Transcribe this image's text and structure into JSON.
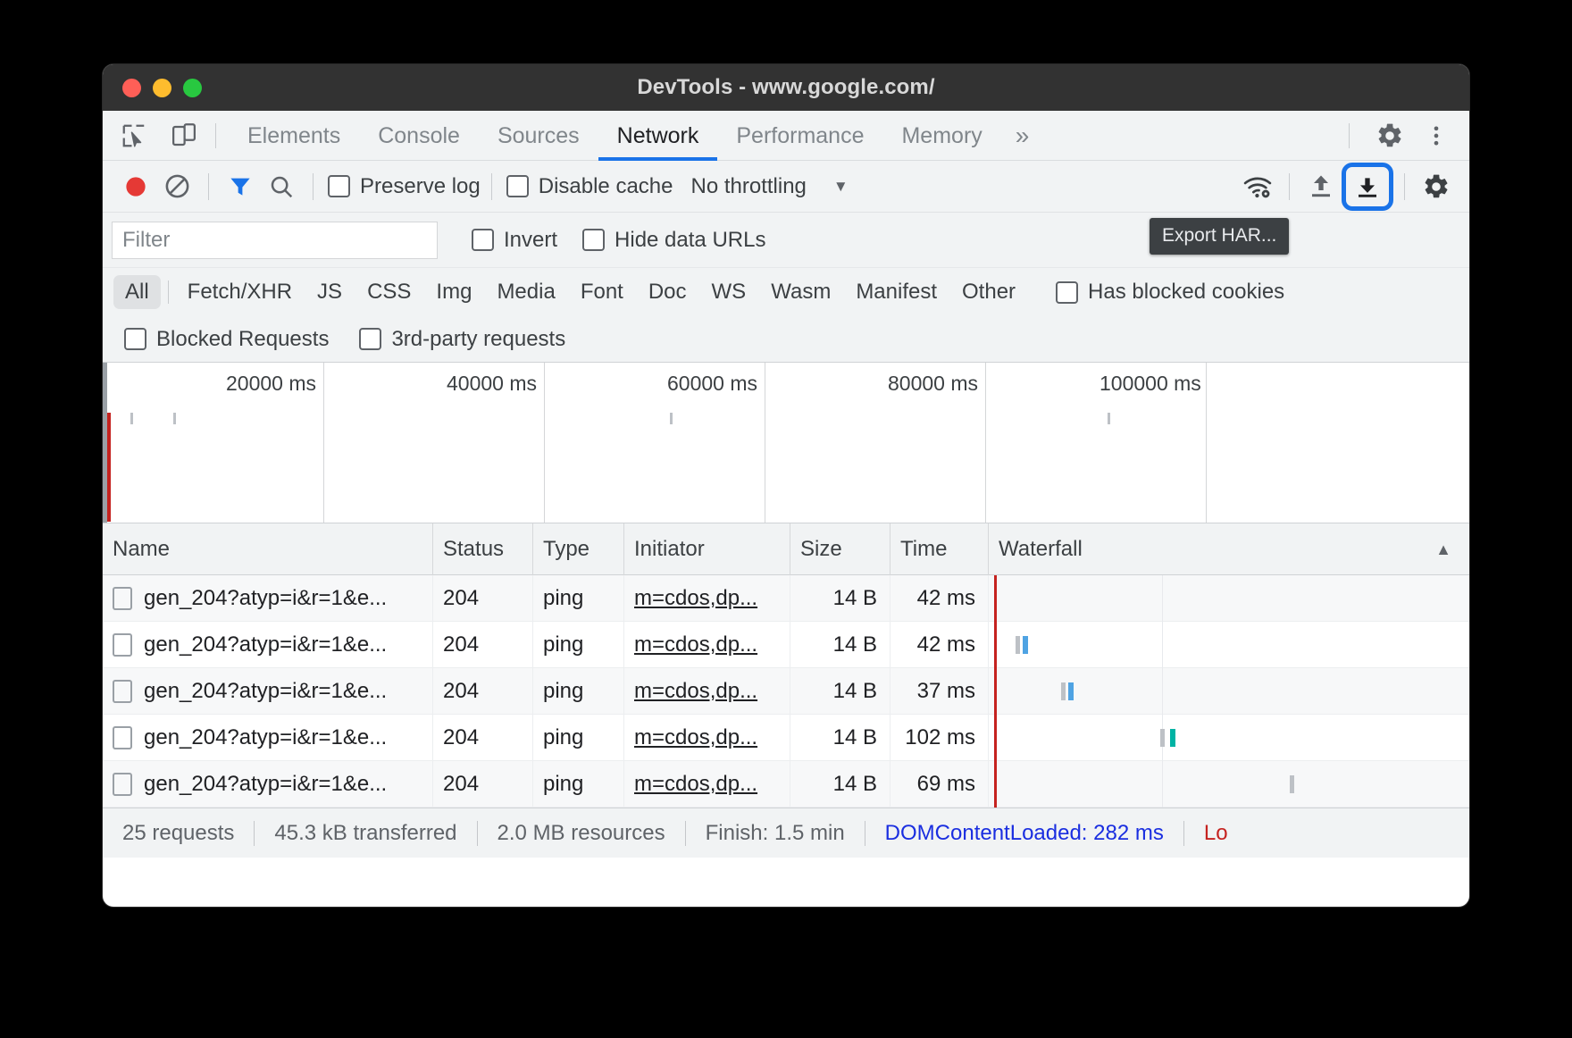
{
  "window": {
    "title": "DevTools - www.google.com/",
    "traffic_lights": [
      "close",
      "minimize",
      "maximize"
    ]
  },
  "tabbar": {
    "inspect_icon": "cursor-select-icon",
    "device_icon": "device-toolbar-icon",
    "tabs": [
      {
        "label": "Elements",
        "active": false
      },
      {
        "label": "Console",
        "active": false
      },
      {
        "label": "Sources",
        "active": false
      },
      {
        "label": "Network",
        "active": true
      },
      {
        "label": "Performance",
        "active": false
      },
      {
        "label": "Memory",
        "active": false
      }
    ],
    "more_tabs": "»",
    "settings_icon": "gear-icon",
    "menu_icon": "kebab-menu-icon",
    "active_tab_color": "#1a73e8"
  },
  "network_toolbar": {
    "record_icon": "record-circle-icon",
    "record_color": "#e53935",
    "clear_icon": "clear-no-entry-icon",
    "filter_icon": "filter-funnel-icon",
    "filter_icon_color": "#1a73e8",
    "search_icon": "search-icon",
    "preserve_log_label": "Preserve log",
    "preserve_log_checked": false,
    "disable_cache_label": "Disable cache",
    "disable_cache_checked": false,
    "throttling_value": "No throttling",
    "throttling_caret": "▼",
    "wifi_icon": "network-conditions-wifi-icon",
    "import_icon": "import-har-upload-icon",
    "export_icon": "export-har-download-icon",
    "export_focused": true,
    "focus_ring_color": "#1a73e8",
    "settings_icon": "gear-icon",
    "tooltip": "Export HAR..."
  },
  "filter_row": {
    "filter_placeholder": "Filter",
    "filter_value": "",
    "invert_label": "Invert",
    "invert_checked": false,
    "hide_data_urls_label": "Hide data URLs",
    "hide_data_urls_checked": false
  },
  "type_filters": {
    "items": [
      {
        "label": "All",
        "active": true
      },
      {
        "label": "Fetch/XHR",
        "active": false
      },
      {
        "label": "JS",
        "active": false
      },
      {
        "label": "CSS",
        "active": false
      },
      {
        "label": "Img",
        "active": false
      },
      {
        "label": "Media",
        "active": false
      },
      {
        "label": "Font",
        "active": false
      },
      {
        "label": "Doc",
        "active": false
      },
      {
        "label": "WS",
        "active": false
      },
      {
        "label": "Wasm",
        "active": false
      },
      {
        "label": "Manifest",
        "active": false
      },
      {
        "label": "Other",
        "active": false
      }
    ],
    "has_blocked_cookies_label": "Has blocked cookies",
    "has_blocked_cookies_checked": false
  },
  "blocked_row": {
    "blocked_requests_label": "Blocked Requests",
    "blocked_requests_checked": false,
    "third_party_label": "3rd-party requests",
    "third_party_checked": false
  },
  "overview": {
    "ticks": [
      "20000 ms",
      "40000 ms",
      "60000 ms",
      "80000 ms",
      "100000 ms"
    ],
    "dcl_marker_color": "#c5221f"
  },
  "table": {
    "columns": [
      "Name",
      "Status",
      "Type",
      "Initiator",
      "Size",
      "Time",
      "Waterfall"
    ],
    "sort_indicator": "▲",
    "rows": [
      {
        "name": "gen_204?atyp=i&r=1&e...",
        "status": "204",
        "type": "ping",
        "initiator": "m=cdos,dp...",
        "size": "14 B",
        "time": "42 ms",
        "partial": true
      },
      {
        "name": "gen_204?atyp=i&r=1&e...",
        "status": "204",
        "type": "ping",
        "initiator": "m=cdos,dp...",
        "size": "14 B",
        "time": "42 ms",
        "partial": false
      },
      {
        "name": "gen_204?atyp=i&r=1&e...",
        "status": "204",
        "type": "ping",
        "initiator": "m=cdos,dp...",
        "size": "14 B",
        "time": "37 ms",
        "partial": false
      },
      {
        "name": "gen_204?atyp=i&r=1&e...",
        "status": "204",
        "type": "ping",
        "initiator": "m=cdos,dp...",
        "size": "14 B",
        "time": "102 ms",
        "partial": false
      },
      {
        "name": "gen_204?atyp=i&r=1&e...",
        "status": "204",
        "type": "ping",
        "initiator": "m=cdos,dp...",
        "size": "14 B",
        "time": "69 ms",
        "partial": false
      }
    ]
  },
  "statusbar": {
    "requests": "25 requests",
    "transferred": "45.3 kB transferred",
    "resources": "2.0 MB resources",
    "finish": "Finish: 1.5 min",
    "dom_content_loaded": "DOMContentLoaded: 282 ms",
    "load": "Lo",
    "dcl_color": "#1a2ee0",
    "load_color": "#c5221f"
  }
}
